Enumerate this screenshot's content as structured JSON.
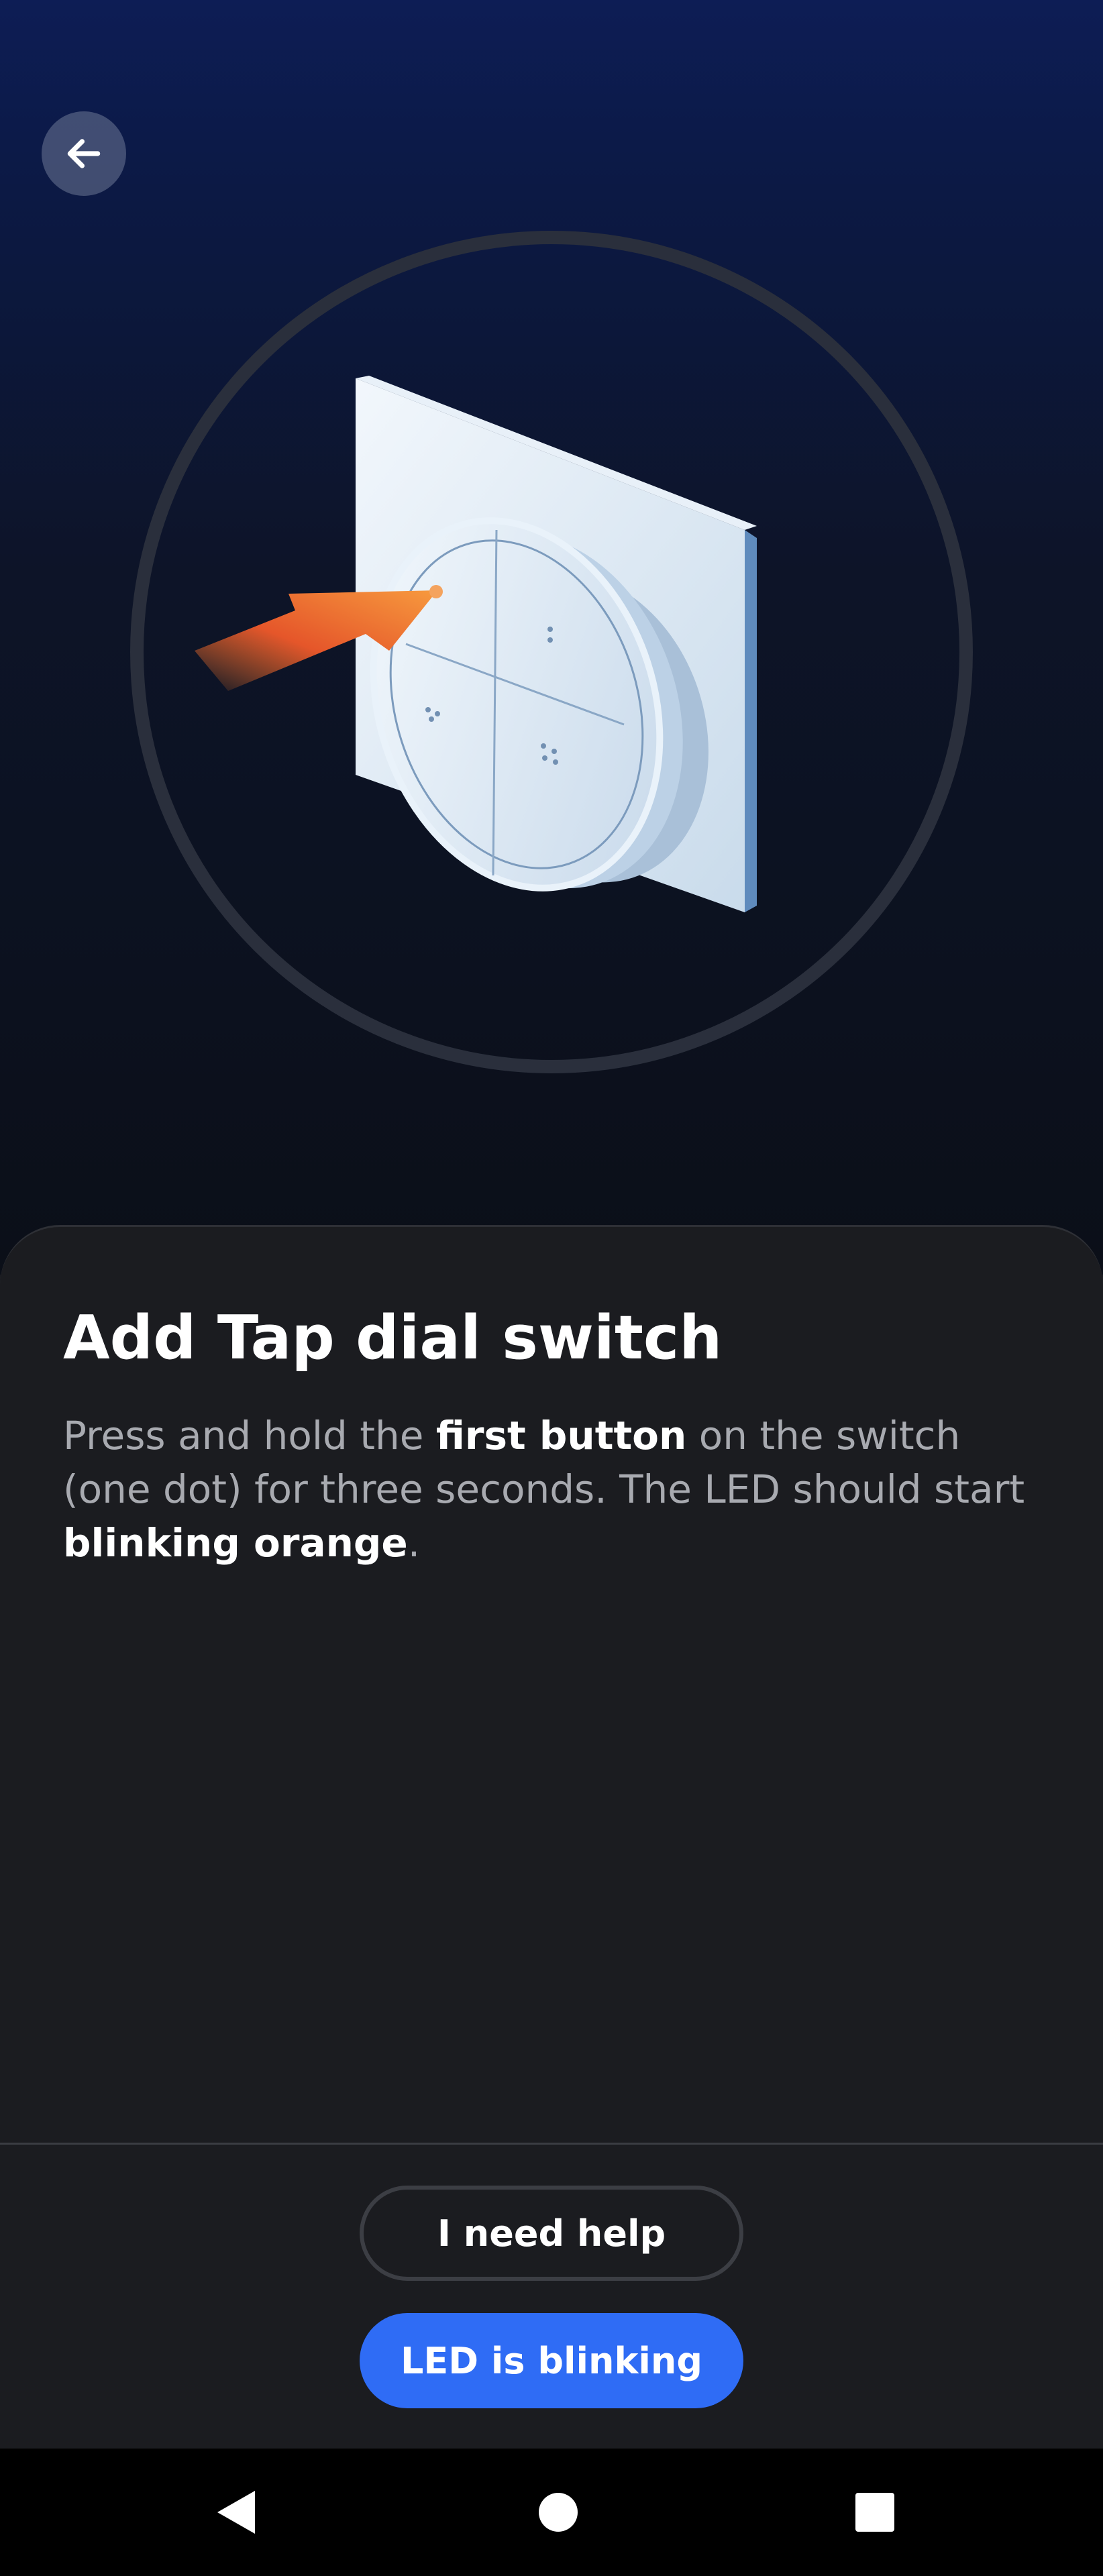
{
  "header": {
    "back_icon": "arrow-left-icon"
  },
  "hero": {
    "illustration": "tap-dial-switch-with-arrow",
    "accent_color": "#f07a2a"
  },
  "content": {
    "title": "Add Tap dial switch",
    "description": {
      "part1": "Press and hold the ",
      "bold1": "first button",
      "part2": " on the switch (one dot) for three seconds. The LED should start ",
      "bold2": "blinking orange",
      "part3": "."
    }
  },
  "actions": {
    "help_label": "I need help",
    "confirm_label": "LED is blinking",
    "confirm_color": "#2f6cf5"
  },
  "navbar": {
    "back": "nav-back-icon",
    "home": "nav-home-icon",
    "recents": "nav-recents-icon"
  }
}
